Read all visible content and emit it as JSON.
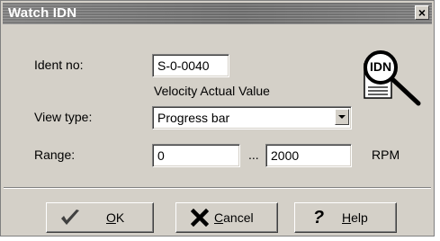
{
  "window": {
    "title": "Watch IDN",
    "close_glyph": "×"
  },
  "ident": {
    "label": "Ident no:",
    "value": "S-0-0040",
    "description": "Velocity Actual Value"
  },
  "view_type": {
    "label": "View type:",
    "selected": "Progress bar"
  },
  "range": {
    "label": "Range:",
    "min": "0",
    "separator": "...",
    "max": "2000",
    "unit": "RPM"
  },
  "logo": {
    "text": "IDN",
    "icon": "magnifier-document-icon"
  },
  "buttons": {
    "ok": {
      "accel": "O",
      "rest": "K",
      "icon": "checkmark-icon"
    },
    "cancel": {
      "accel": "C",
      "rest": "ancel",
      "icon": "cross-icon"
    },
    "help": {
      "accel": "H",
      "rest": "elp",
      "icon": "question-icon"
    }
  },
  "colors": {
    "dialog_bg": "#d4d0c8",
    "titlebar": "#6f6f6f",
    "ok_check": "#404040",
    "cancel_x": "#000000"
  }
}
